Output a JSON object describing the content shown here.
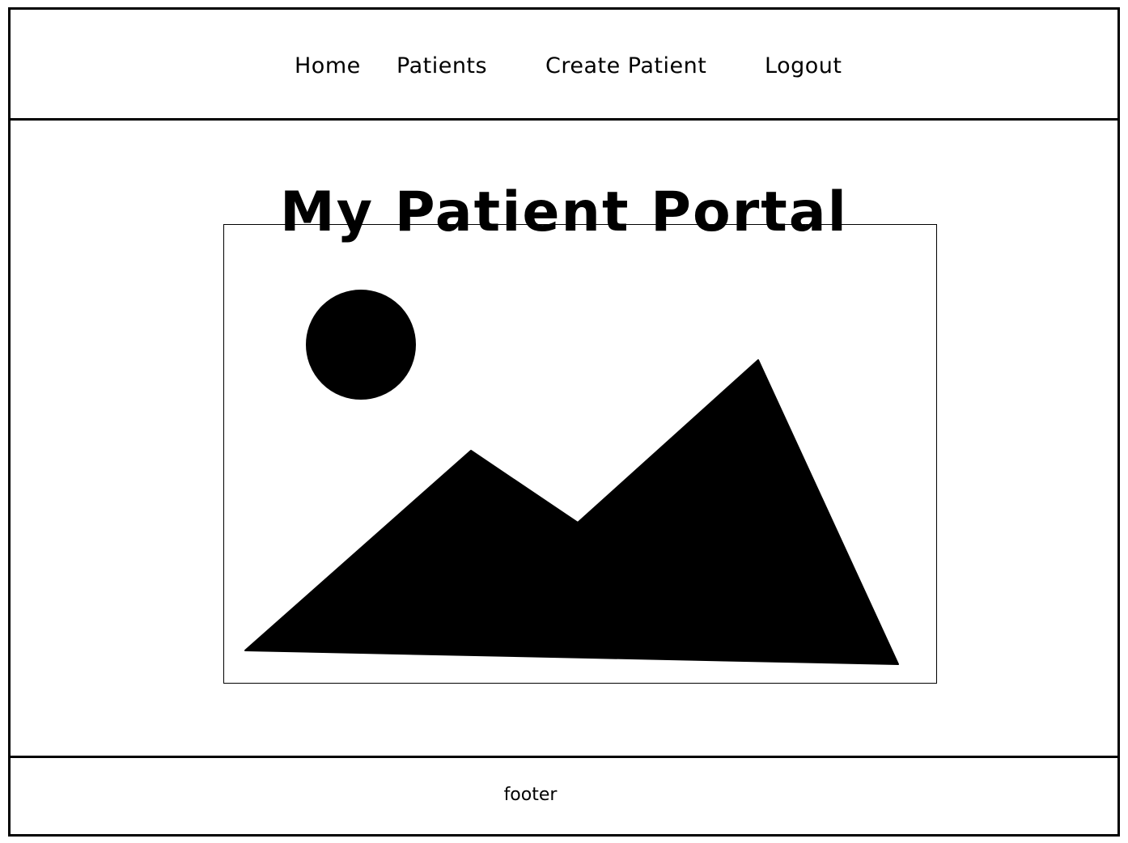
{
  "nav": {
    "items": [
      {
        "label": "Home"
      },
      {
        "label": "Patients"
      },
      {
        "label": "Create Patient"
      },
      {
        "label": "Logout"
      }
    ]
  },
  "main": {
    "title": "My Patient Portal",
    "hero_image": {
      "icon": "image-placeholder-icon",
      "depicts": [
        "sun",
        "mountains"
      ]
    }
  },
  "footer": {
    "text": "footer"
  },
  "colors": {
    "ink": "#000000",
    "background": "#ffffff"
  }
}
